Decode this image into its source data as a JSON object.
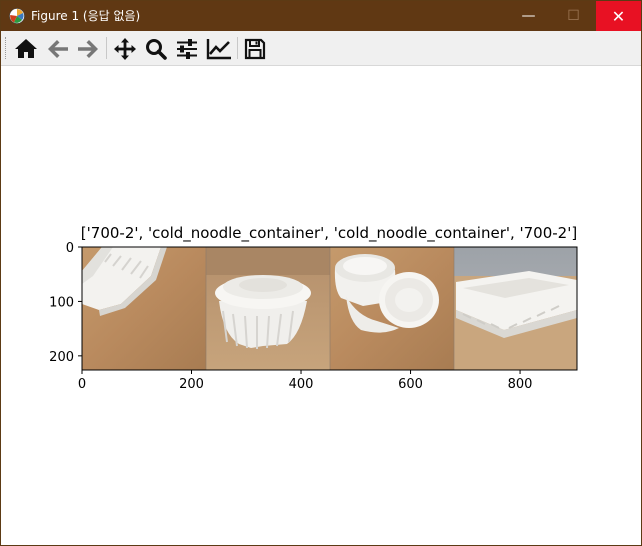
{
  "window": {
    "title": "Figure 1 (응답 없음)",
    "minimize_glyph": "—",
    "maximize_glyph": "☐",
    "close_glyph": "✕",
    "close_color": "#e81123",
    "titlebar_color": "#603813"
  },
  "toolbar": {
    "buttons": [
      {
        "name": "home-button",
        "icon": "home-icon"
      },
      {
        "name": "back-button",
        "icon": "arrow-left-icon"
      },
      {
        "name": "forward-button",
        "icon": "arrow-right-icon"
      },
      {
        "name": "pan-button",
        "icon": "move-icon"
      },
      {
        "name": "zoom-button",
        "icon": "magnifier-icon"
      },
      {
        "name": "subplots-button",
        "icon": "sliders-icon"
      },
      {
        "name": "edit-axes-button",
        "icon": "chart-line-icon"
      },
      {
        "name": "save-button",
        "icon": "floppy-disk-icon"
      }
    ]
  },
  "figure": {
    "title": "['700-2', 'cold_noodle_container', 'cold_noodle_container', '700-2']",
    "xticks": [
      "0",
      "200",
      "400",
      "600",
      "800"
    ],
    "yticks": [
      "0",
      "100",
      "200"
    ],
    "panels": [
      "700-2",
      "cold_noodle_container",
      "cold_noodle_container",
      "700-2"
    ]
  },
  "chart_data": {
    "type": "image",
    "title": "['700-2', 'cold_noodle_container', 'cold_noodle_container', '700-2']",
    "x_ticks": [
      0,
      200,
      400,
      600,
      800
    ],
    "y_ticks": [
      0,
      100,
      200
    ],
    "xlim": [
      0,
      904
    ],
    "ylim": [
      226,
      0
    ],
    "image_width": 904,
    "image_height": 226,
    "panel_width": 226,
    "panels": [
      "700-2",
      "cold_noodle_container",
      "cold_noodle_container",
      "700-2"
    ]
  }
}
